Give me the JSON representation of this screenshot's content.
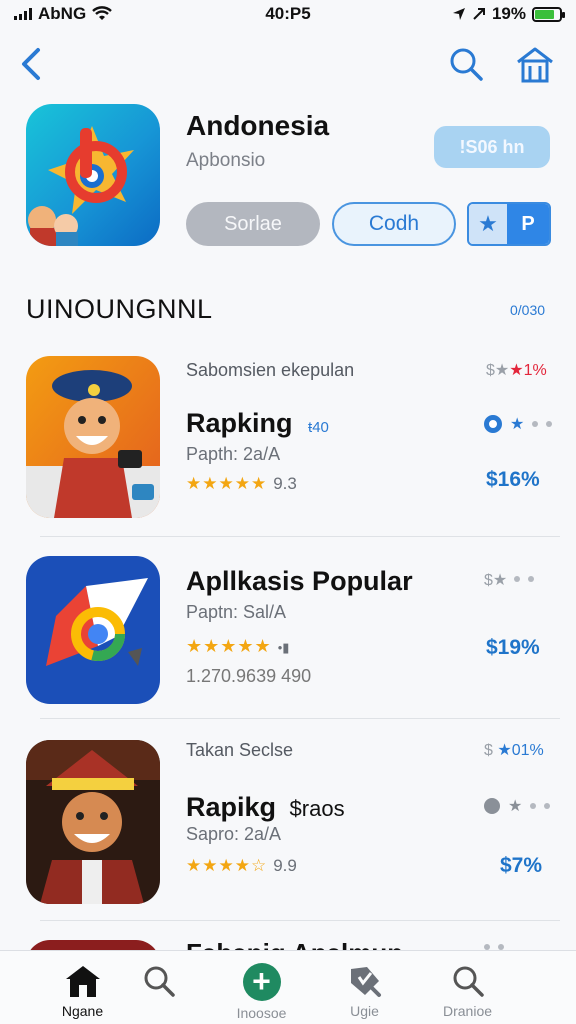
{
  "status_bar": {
    "carrier": "AbNG",
    "time": "40:P5",
    "battery": "19%",
    "battery_level": 0.8
  },
  "nav": {
    "back_icon": "chevron-left-icon",
    "search_icon": "search-icon",
    "home_icon": "home-icon"
  },
  "header": {
    "title": "Andonesia",
    "subtitle": "Apbonsio",
    "price_button": "!S06 hn",
    "secondary_button": "Sorlae",
    "outline_button": "Codh",
    "toggle_right": "P"
  },
  "section": {
    "title": "UINOUNGNNL",
    "link": "0/030"
  },
  "apps": [
    {
      "tag": "Sabomsien ekepulan",
      "name": "Rapking",
      "name_suffix": "ŧ40",
      "meta": "Papth: 2a/A",
      "stars": "★★★★★",
      "rating": "9.3",
      "right_top": "$★",
      "right_top_red": "★1%",
      "price": "$16%"
    },
    {
      "tag": "",
      "name": "Apllkasis Popular",
      "name_suffix": "",
      "meta": "Paptn: Sal/A",
      "stars": "★★★★★",
      "rating": "",
      "count": "1.270.9639 490",
      "right_top": "$★",
      "right_top_red": "",
      "price": "$19%"
    },
    {
      "tag": "Takan Seclse",
      "name": "Rapikg",
      "name_suffix": "$raos",
      "meta": "Sapro: 2a/A",
      "stars": "★★★★☆",
      "rating": "9.9",
      "right_top": "$ ",
      "right_top_red": "★01%",
      "price": "$7%"
    }
  ],
  "partial_row_title": "Fabanig Apalmun",
  "tabs": [
    {
      "label": "Ngane",
      "icon": "home-icon"
    },
    {
      "label": "",
      "icon": "search-icon"
    },
    {
      "label": "Inoosoe",
      "icon": "plus-icon"
    },
    {
      "label": "Ugie",
      "icon": "tag-icon"
    },
    {
      "label": "Dranioe",
      "icon": "search-icon"
    }
  ],
  "colors": {
    "accent": "#2a7ad3",
    "price": "#1f74c9",
    "star": "#f3a612",
    "tab_plus": "#1f8a61"
  }
}
